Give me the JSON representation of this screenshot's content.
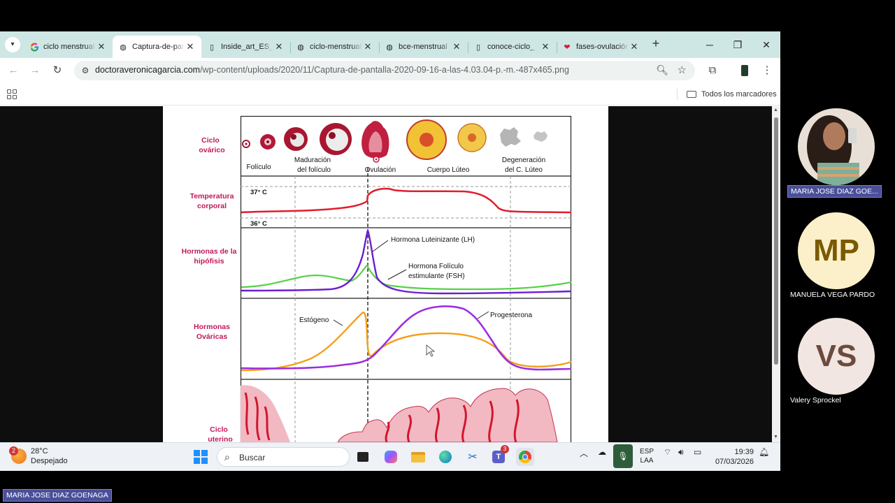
{
  "browser": {
    "tabs": [
      {
        "title": "ciclo menstrual",
        "favicon": "google-icon",
        "active": false
      },
      {
        "title": "Captura-de-pantalla",
        "favicon": "globe-icon",
        "active": true
      },
      {
        "title": "Inside_art_ES_",
        "favicon": "document-icon",
        "active": false
      },
      {
        "title": "ciclo-menstrual",
        "favicon": "globe-icon",
        "active": false
      },
      {
        "title": "bce-menstrual",
        "favicon": "globe-icon",
        "active": false
      },
      {
        "title": "conoce-ciclo_",
        "favicon": "document-icon",
        "active": false
      },
      {
        "title": "fases-ovulación",
        "favicon": "heart-icon",
        "active": false
      }
    ],
    "url_host": "doctoraveronicagarcia.com",
    "url_path": "/wp-content/uploads/2020/11/Captura-de-pantalla-2020-09-16-a-las-4.03.04-p.-m.-487x465.png",
    "bookmarks_folder": "Todos los marcadores"
  },
  "figure": {
    "row_labels": {
      "ovarian": [
        "Ciclo",
        "ovárico"
      ],
      "temp": [
        "Temperatura",
        "corporal"
      ],
      "pituitary": [
        "Hormonas de la",
        "hipófisis"
      ],
      "ovarian_hormones": [
        "Hormonas",
        "Ováricas"
      ],
      "uterine": [
        "Ciclo",
        "uterino"
      ]
    },
    "stage_labels": {
      "follicle": "Folículo",
      "maturation": [
        "Maduración",
        "del folículo"
      ],
      "ovulation": "Ovulación",
      "corpus": "Cuerpo Lúteo",
      "degeneration": [
        "Degeneración",
        "del C. Lúteo"
      ]
    },
    "temp_high": "37° C",
    "temp_low": "36° C",
    "lh_label": "Hormona Luteinizante (LH)",
    "fsh_label": [
      "Hormona Folículo",
      "estimulante (FSH)"
    ],
    "estrogen_label": "Estógeno",
    "progesterone_label": "Progesterona",
    "colors": {
      "label_magenta": "#c2185b",
      "temp_line": "#e01e2e",
      "lh": "#6a1fd1",
      "fsh": "#59d04a",
      "estrogen": "#f2a01c",
      "progesterone": "#9b2fe0"
    }
  },
  "taskbar": {
    "weather_badge": "2",
    "weather_temp": "28°C",
    "weather_desc": "Despejado",
    "search_placeholder": "Buscar",
    "teams_badge": "3",
    "lang_line1": "ESP",
    "lang_line2": "LAA",
    "time": "19:39",
    "date": "07/03/2026"
  },
  "participants": [
    {
      "name": "MARIA JOSE DIAZ GOE...",
      "initials": "",
      "highlight": true
    },
    {
      "name": "MANUELA VEGA PARDO",
      "initials": "MP",
      "highlight": false
    },
    {
      "name": "Valery Sprockel",
      "initials": "VS",
      "highlight": false
    }
  ],
  "active_speaker_name": "MARIA JOSE DIAZ GOENAGA"
}
